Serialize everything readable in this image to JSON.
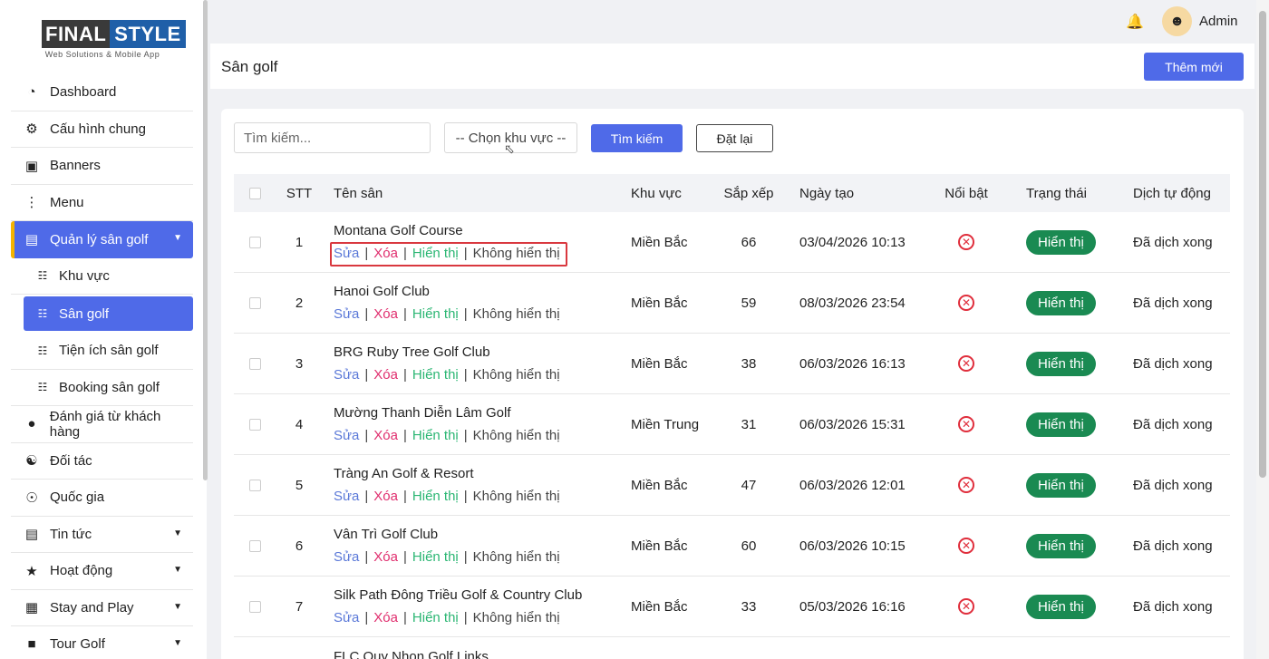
{
  "logo": {
    "part1": "FINAL",
    "part2": "STYLE",
    "tagline": "Web Solutions & Mobile App"
  },
  "sidebar": {
    "items": [
      {
        "label": "Dashboard",
        "icon": "gauge-icon"
      },
      {
        "label": "Cấu hình chung",
        "icon": "gear-icon"
      },
      {
        "label": "Banners",
        "icon": "images-icon"
      },
      {
        "label": "Menu",
        "icon": "vertical-dots-icon"
      },
      {
        "label": "Quản lý sân golf",
        "icon": "store-icon"
      },
      {
        "label": "Khu vực",
        "icon": "sitemap-icon"
      },
      {
        "label": "Sân golf",
        "icon": "sitemap-icon"
      },
      {
        "label": "Tiện ích sân golf",
        "icon": "sitemap-icon"
      },
      {
        "label": "Booking sân golf",
        "icon": "sitemap-icon"
      },
      {
        "label": "Đánh giá từ khách hàng",
        "icon": "comment-icon"
      },
      {
        "label": "Đối tác",
        "icon": "handshake-icon"
      },
      {
        "label": "Quốc gia",
        "icon": "globe-icon"
      },
      {
        "label": "Tin tức",
        "icon": "newspaper-icon"
      },
      {
        "label": "Hoạt động",
        "icon": "trophy-icon"
      },
      {
        "label": "Stay and Play",
        "icon": "building-icon"
      },
      {
        "label": "Tour Golf",
        "icon": "briefcase-icon"
      }
    ]
  },
  "header": {
    "user": "Admin"
  },
  "page": {
    "title": "Sân golf",
    "add_label": "Thêm mới"
  },
  "filters": {
    "search_placeholder": "Tìm kiếm...",
    "region_label": "-- Chọn khu vực --",
    "search_label": "Tìm kiếm",
    "reset_label": "Đặt lại"
  },
  "table": {
    "headers": {
      "stt": "STT",
      "name": "Tên sân",
      "region": "Khu vực",
      "sort": "Sắp xếp",
      "date": "Ngày tạo",
      "featured": "Nổi bật",
      "status": "Trạng thái",
      "translate": "Dịch tự động"
    },
    "actions": {
      "edit": "Sửa",
      "delete": "Xóa",
      "show": "Hiển thị",
      "hide": "Không hiển thị",
      "sep": "|"
    },
    "rows": [
      {
        "stt": "1",
        "name": "Montana Golf Course",
        "region": "Miền Bắc",
        "sort": "66",
        "date": "03/04/2026 10:13",
        "status": "Hiển thị",
        "translate": "Đã dịch xong"
      },
      {
        "stt": "2",
        "name": "Hanoi Golf Club",
        "region": "Miền Bắc",
        "sort": "59",
        "date": "08/03/2026 23:54",
        "status": "Hiển thị",
        "translate": "Đã dịch xong"
      },
      {
        "stt": "3",
        "name": "BRG Ruby Tree Golf Club",
        "region": "Miền Bắc",
        "sort": "38",
        "date": "06/03/2026 16:13",
        "status": "Hiển thị",
        "translate": "Đã dịch xong"
      },
      {
        "stt": "4",
        "name": "Mường Thanh Diễn Lâm Golf",
        "region": "Miền Trung",
        "sort": "31",
        "date": "06/03/2026 15:31",
        "status": "Hiển thị",
        "translate": "Đã dịch xong"
      },
      {
        "stt": "5",
        "name": "Tràng An Golf & Resort",
        "region": "Miền Bắc",
        "sort": "47",
        "date": "06/03/2026 12:01",
        "status": "Hiển thị",
        "translate": "Đã dịch xong"
      },
      {
        "stt": "6",
        "name": "Vân Trì Golf Club",
        "region": "Miền Bắc",
        "sort": "60",
        "date": "06/03/2026 10:15",
        "status": "Hiển thị",
        "translate": "Đã dịch xong"
      },
      {
        "stt": "7",
        "name": "Silk Path Đông Triều Golf & Country Club",
        "region": "Miền Bắc",
        "sort": "33",
        "date": "05/03/2026 16:16",
        "status": "Hiển thị",
        "translate": "Đã dịch xong"
      }
    ],
    "partial_row": {
      "name": "FLC Quy Nhon Golf Links"
    }
  },
  "colors": {
    "accent": "#4f6ae8",
    "status_green": "#1a8a52",
    "delete_red": "#e02e6e"
  }
}
